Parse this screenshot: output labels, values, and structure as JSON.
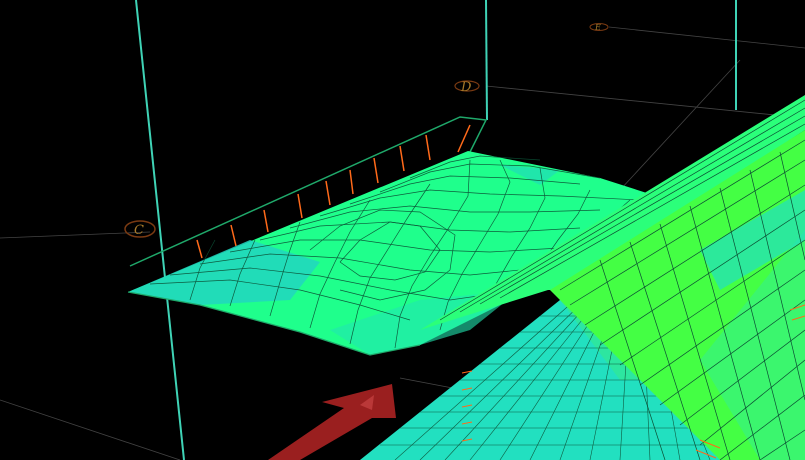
{
  "viewer": {
    "colors": {
      "background": "#000000",
      "grid_column": "#3fd3b6",
      "grid_line": "#5a5a5a",
      "slab": "#1fff8c",
      "slab_edge": "#1fa86a",
      "slab_load": "#ff6a1a",
      "wall_cyan": "#22e0c0",
      "wall_green": "#44ff44",
      "mesh_line": "#0b4d33",
      "arrow": "#9a1f1f"
    },
    "grid_labels": {
      "c": "C",
      "d": "D",
      "e": "E"
    },
    "icons": [
      "grid-bubble-icon",
      "load-arrow-icon"
    ]
  }
}
